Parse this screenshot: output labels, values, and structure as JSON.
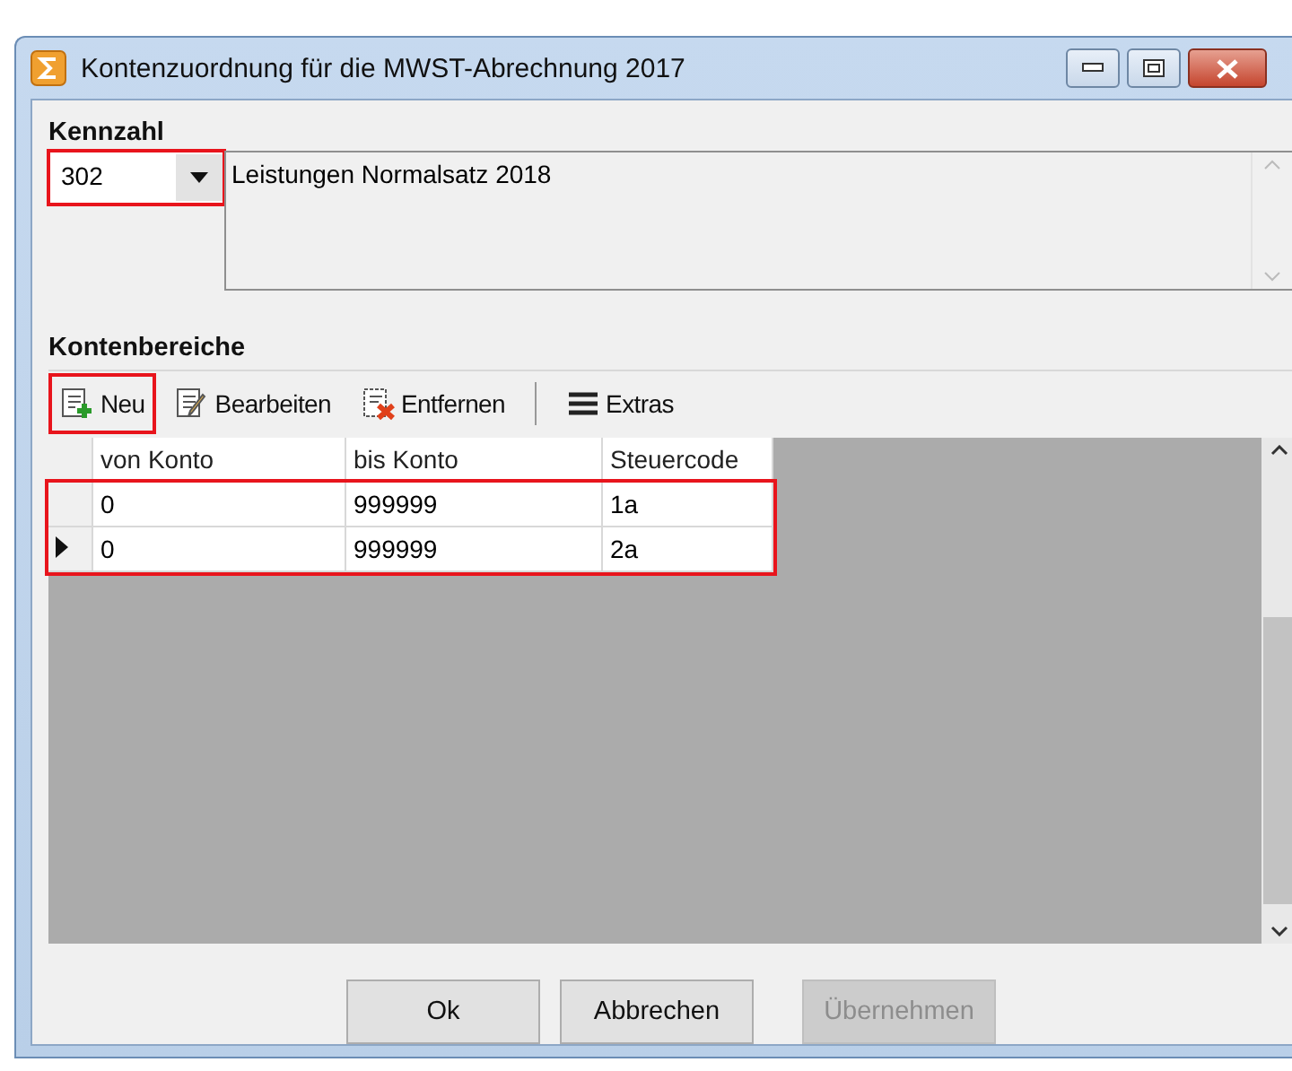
{
  "window": {
    "title": "Kontenzuordnung für die MWST-Abrechnung 2017"
  },
  "kennzahl": {
    "label": "Kennzahl",
    "value": "302",
    "highlighted": true,
    "description": "Leistungen Normalsatz 2018"
  },
  "kontenbereiche": {
    "label": "Kontenbereiche"
  },
  "toolbar": [
    {
      "kind": "new",
      "label": "Neu",
      "highlighted": true
    },
    {
      "kind": "edit",
      "label": "Bearbeiten",
      "highlighted": false
    },
    {
      "kind": "delete",
      "label": "Entfernen",
      "highlighted": false
    },
    {
      "kind": "menu",
      "label": "Extras",
      "highlighted": false
    }
  ],
  "table": {
    "columns": [
      "von Konto",
      "bis Konto",
      "Steuercode"
    ],
    "rows_highlighted": true,
    "rows": [
      {
        "cells": [
          "0",
          "999999",
          "1a"
        ],
        "selected": false
      },
      {
        "cells": [
          "0",
          "999999",
          "2a"
        ],
        "selected": true
      }
    ]
  },
  "buttons": [
    {
      "label": "Ok",
      "disabled": false
    },
    {
      "label": "Abbrechen",
      "disabled": false
    },
    {
      "label": "Übernehmen",
      "disabled": true
    }
  ]
}
